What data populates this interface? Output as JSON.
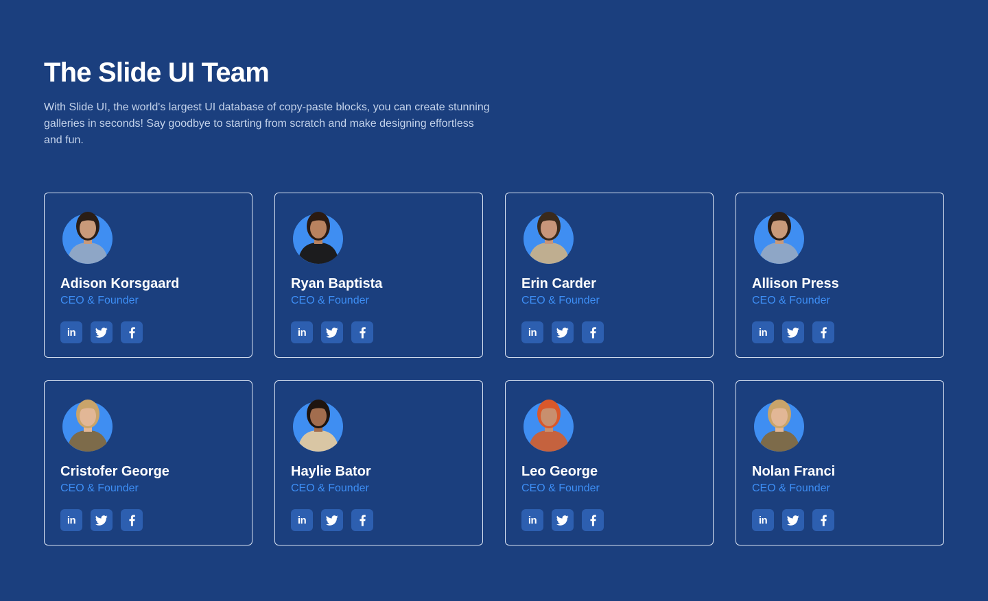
{
  "header": {
    "title": "The Slide UI Team",
    "description": "With Slide UI, the world's largest UI database of copy-paste blocks, you can create stunning galleries in seconds! Say goodbye to starting from scratch and make designing effortless and fun."
  },
  "social": {
    "linkedin_label": "in",
    "linkedin_icon": "linkedin-icon",
    "twitter_icon": "twitter-icon",
    "facebook_icon": "facebook-icon"
  },
  "team": [
    {
      "name": "Adison Korsgaard",
      "role": "CEO & Founder",
      "hair": "#2a1d16",
      "skin": "#c99a7a",
      "shirt": "#8ea6c6"
    },
    {
      "name": "Ryan Baptista",
      "role": "CEO & Founder",
      "hair": "#2b1a12",
      "skin": "#b9825f",
      "shirt": "#1c1c1e"
    },
    {
      "name": "Erin Carder",
      "role": "CEO & Founder",
      "hair": "#3a2a1c",
      "skin": "#c8967a",
      "shirt": "#bfae90"
    },
    {
      "name": "Allison Press",
      "role": "CEO & Founder",
      "hair": "#2a1d16",
      "skin": "#c99a7a",
      "shirt": "#8ea6c6"
    },
    {
      "name": "Cristofer George",
      "role": "CEO & Founder",
      "hair": "#c9a46a",
      "skin": "#e2b796",
      "shirt": "#7d6b4a"
    },
    {
      "name": "Haylie Bator",
      "role": "CEO & Founder",
      "hair": "#1e140f",
      "skin": "#a26d4e",
      "shirt": "#d9c6a4"
    },
    {
      "name": "Leo George",
      "role": "CEO & Founder",
      "hair": "#d9582b",
      "skin": "#c88f6e",
      "shirt": "#c5623e"
    },
    {
      "name": "Nolan Franci",
      "role": "CEO & Founder",
      "hair": "#c9a46a",
      "skin": "#e2b796",
      "shirt": "#7d6b4a"
    }
  ],
  "colors": {
    "background": "#1b3f7e",
    "accent": "#3d8ef5",
    "icon_bg": "#2d5fb0",
    "border": "#dbe4f3"
  }
}
